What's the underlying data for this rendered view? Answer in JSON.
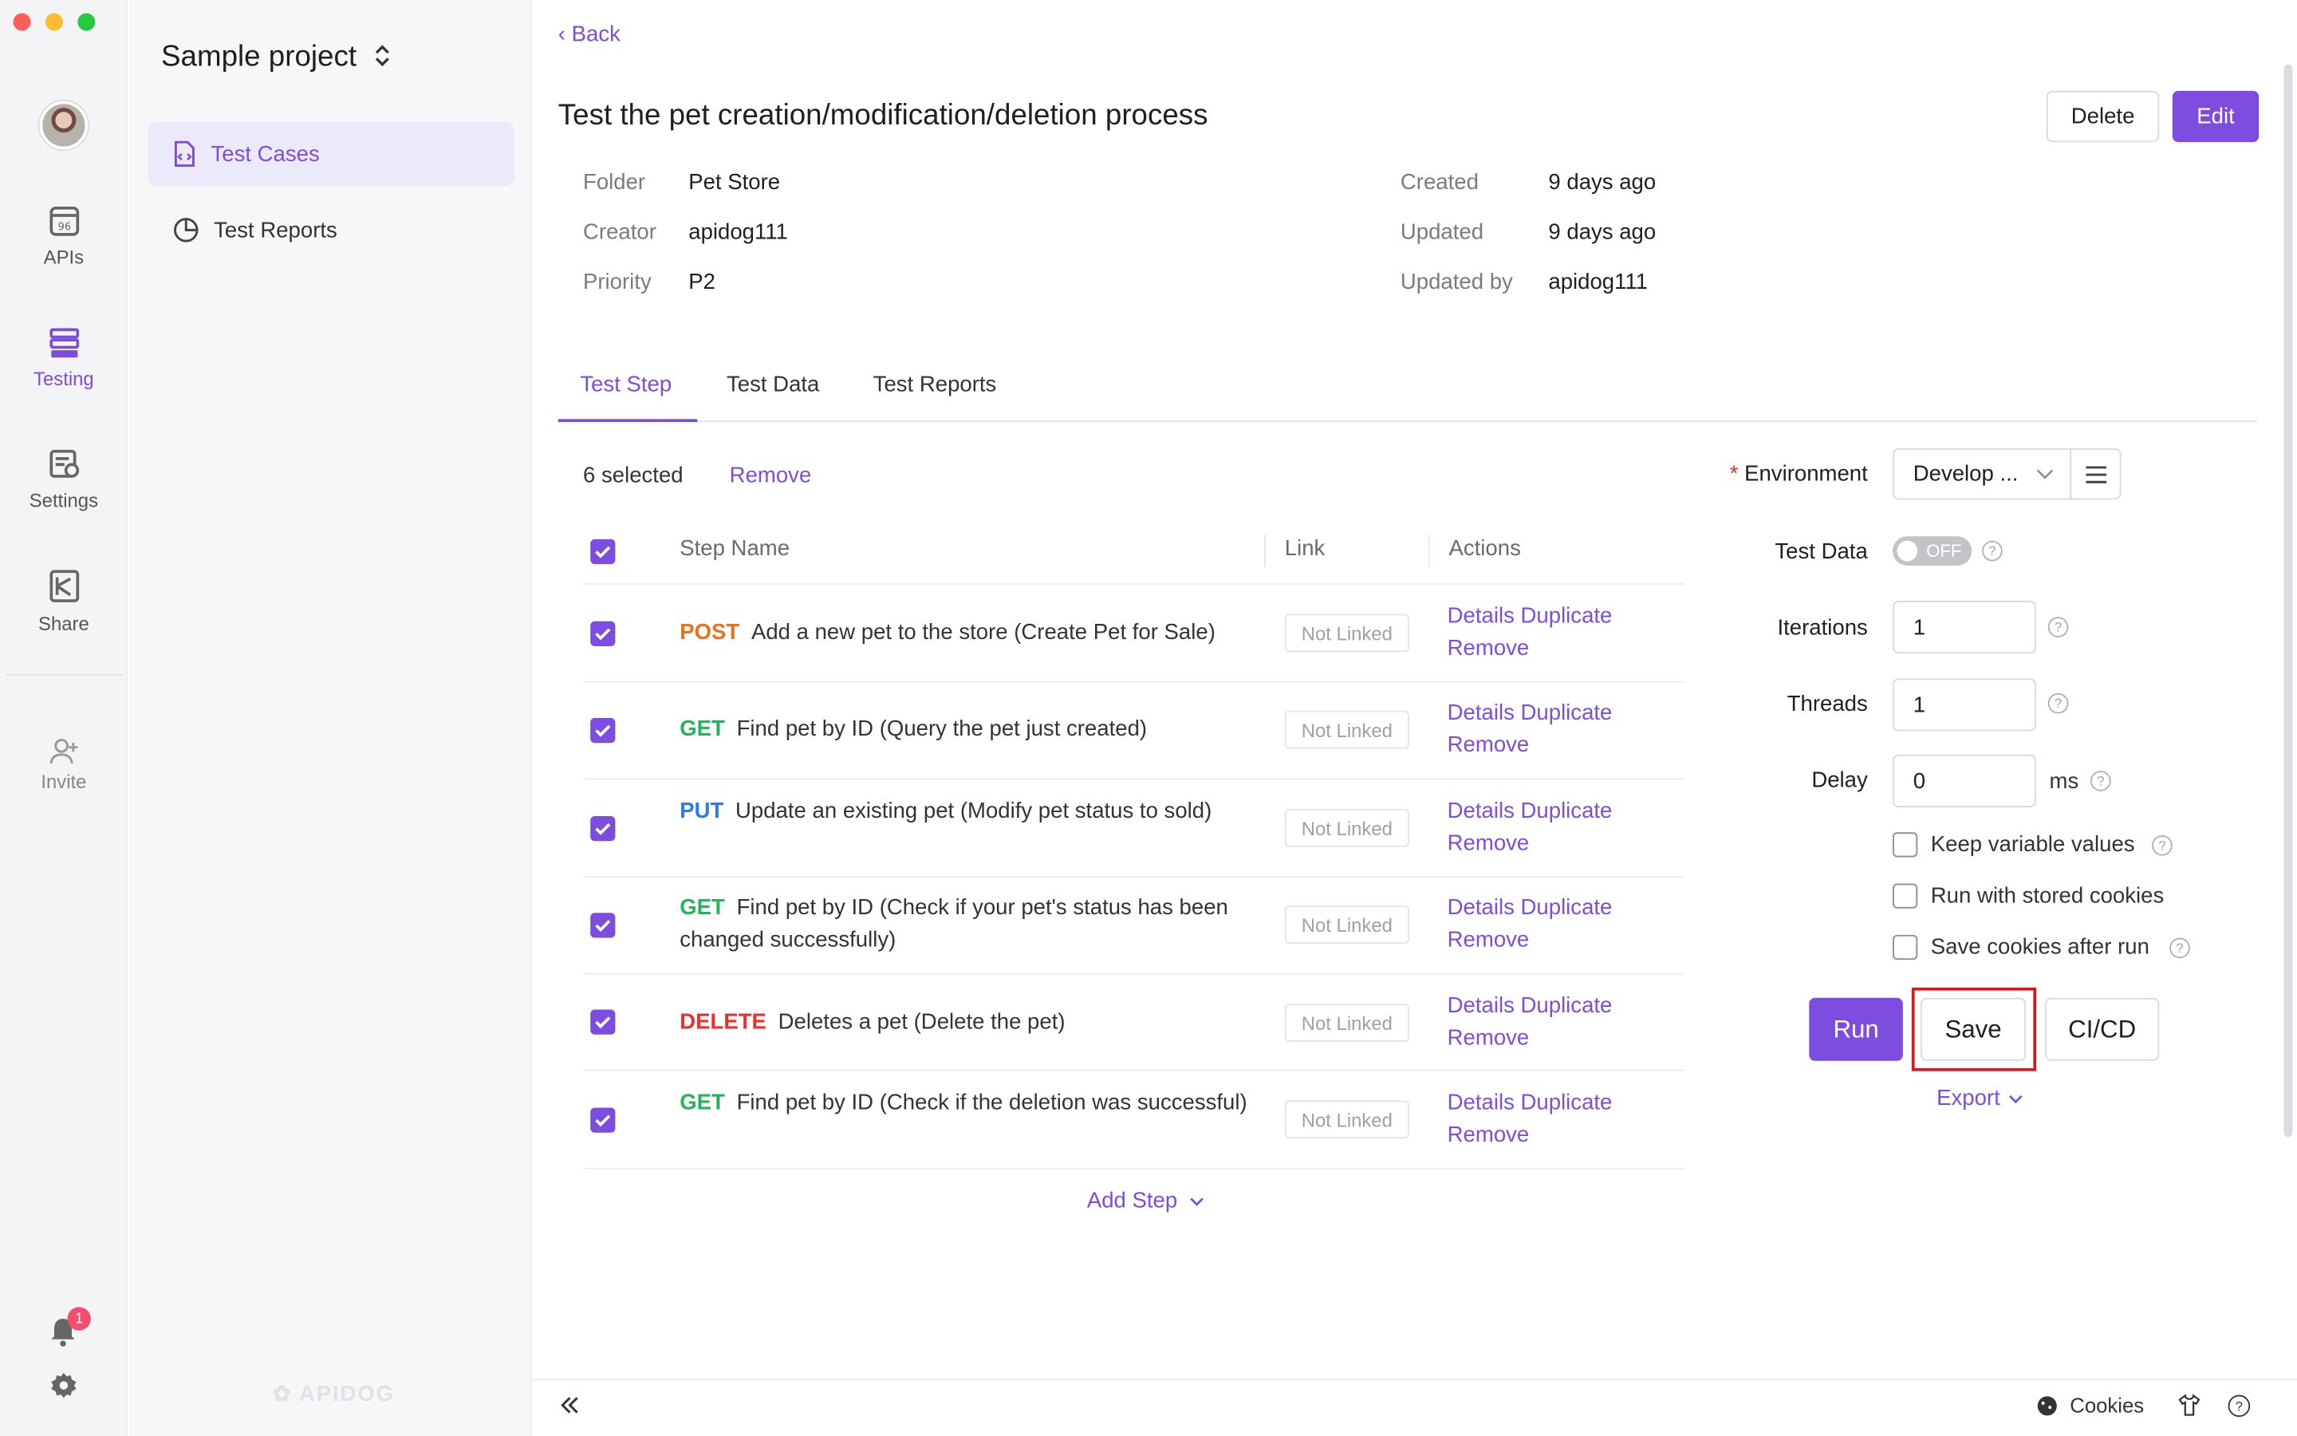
{
  "rail": {
    "items": [
      {
        "label": "APIs",
        "icon": "apis-icon"
      },
      {
        "label": "Testing",
        "icon": "testing-icon"
      },
      {
        "label": "Settings",
        "icon": "settings-icon"
      },
      {
        "label": "Share",
        "icon": "share-icon"
      },
      {
        "label": "Invite",
        "icon": "invite-icon"
      }
    ],
    "notification_count": "1",
    "colors": {
      "close": "#ff5f57",
      "minimize": "#febc2e",
      "maximize": "#28c840"
    }
  },
  "sidebar": {
    "project": "Sample project",
    "items": [
      {
        "label": "Test Cases",
        "icon": "test-cases-icon"
      },
      {
        "label": "Test Reports",
        "icon": "test-reports-icon"
      }
    ],
    "logo_text": "APIDOG"
  },
  "header": {
    "back": "Back",
    "title": "Test the pet creation/modification/deletion process",
    "delete": "Delete",
    "edit": "Edit"
  },
  "meta": {
    "folder_k": "Folder",
    "folder_v": "Pet Store",
    "creator_k": "Creator",
    "creator_v": "apidog111",
    "priority_k": "Priority",
    "priority_v": "P2",
    "created_k": "Created",
    "created_v": "9 days ago",
    "updated_k": "Updated",
    "updated_v": "9 days ago",
    "updatedby_k": "Updated by",
    "updatedby_v": "apidog111"
  },
  "tabs": [
    "Test Step",
    "Test Data",
    "Test Reports"
  ],
  "selection": {
    "count": "6 selected",
    "remove": "Remove"
  },
  "table": {
    "headers": {
      "step": "Step Name",
      "link": "Link",
      "actions": "Actions"
    },
    "rows": [
      {
        "method": "POST",
        "color": "#e8711a",
        "name": "Add a new pet to the store (Create Pet for Sale)",
        "link": "Not Linked",
        "actions": "Details Duplicate Remove"
      },
      {
        "method": "GET",
        "color": "#22b55d",
        "name": "Find pet by ID (Query the pet just created)",
        "link": "Not Linked",
        "actions": "Details Duplicate Remove"
      },
      {
        "method": "PUT",
        "color": "#2f7bea",
        "name": "Update an existing pet (Modify pet status to sold)",
        "link": "Not Linked",
        "actions": "Details Duplicate Remove"
      },
      {
        "method": "GET",
        "color": "#22b55d",
        "name": "Find pet by ID (Check if your pet's status has been changed successfully)",
        "link": "Not Linked",
        "actions": "Details Duplicate Remove"
      },
      {
        "method": "DELETE",
        "color": "#e5322d",
        "name": "Deletes a pet (Delete the pet)",
        "link": "Not Linked",
        "actions": "Details Duplicate Remove"
      },
      {
        "method": "GET",
        "color": "#22b55d",
        "name": "Find pet by ID (Check if the deletion was successful)",
        "link": "Not Linked",
        "actions": "Details Duplicate Remove"
      }
    ],
    "add_step": "Add Step"
  },
  "config": {
    "environment_label": "Environment",
    "environment_value": "Develop ...",
    "test_data_label": "Test Data",
    "test_data_toggle": "OFF",
    "iterations_label": "Iterations",
    "iterations_value": "1",
    "threads_label": "Threads",
    "threads_value": "1",
    "delay_label": "Delay",
    "delay_value": "0",
    "delay_unit": "ms",
    "options": [
      "Keep variable values",
      "Run with stored cookies",
      "Save cookies after run"
    ],
    "run": "Run",
    "save": "Save",
    "cicd": "CI/CD",
    "export": "Export"
  },
  "footer": {
    "cookies": "Cookies"
  },
  "accent": "#7c4dde"
}
